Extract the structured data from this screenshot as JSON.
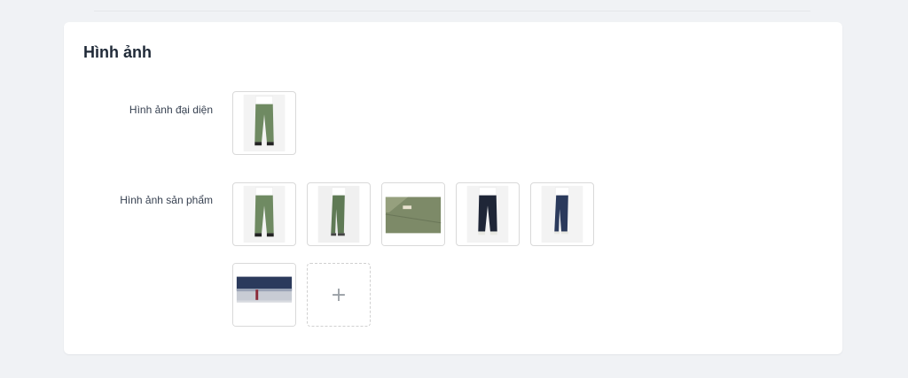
{
  "section": {
    "title": "Hình ảnh",
    "representative_label": "Hình ảnh đại diện",
    "product_label": "Hình ảnh sản phẩm",
    "upload_icon": "+"
  },
  "images": {
    "representative": [
      "olive-chino-front"
    ],
    "product": [
      "olive-chino-front",
      "olive-chino-side",
      "olive-fabric-closeup",
      "navy-jeans-front",
      "navy-jeans-side",
      "selvedge-denim-cuff"
    ]
  },
  "colors": {
    "olive": "#6f8a62",
    "navy": "#1f2637",
    "denim": "#2b3a5c"
  }
}
